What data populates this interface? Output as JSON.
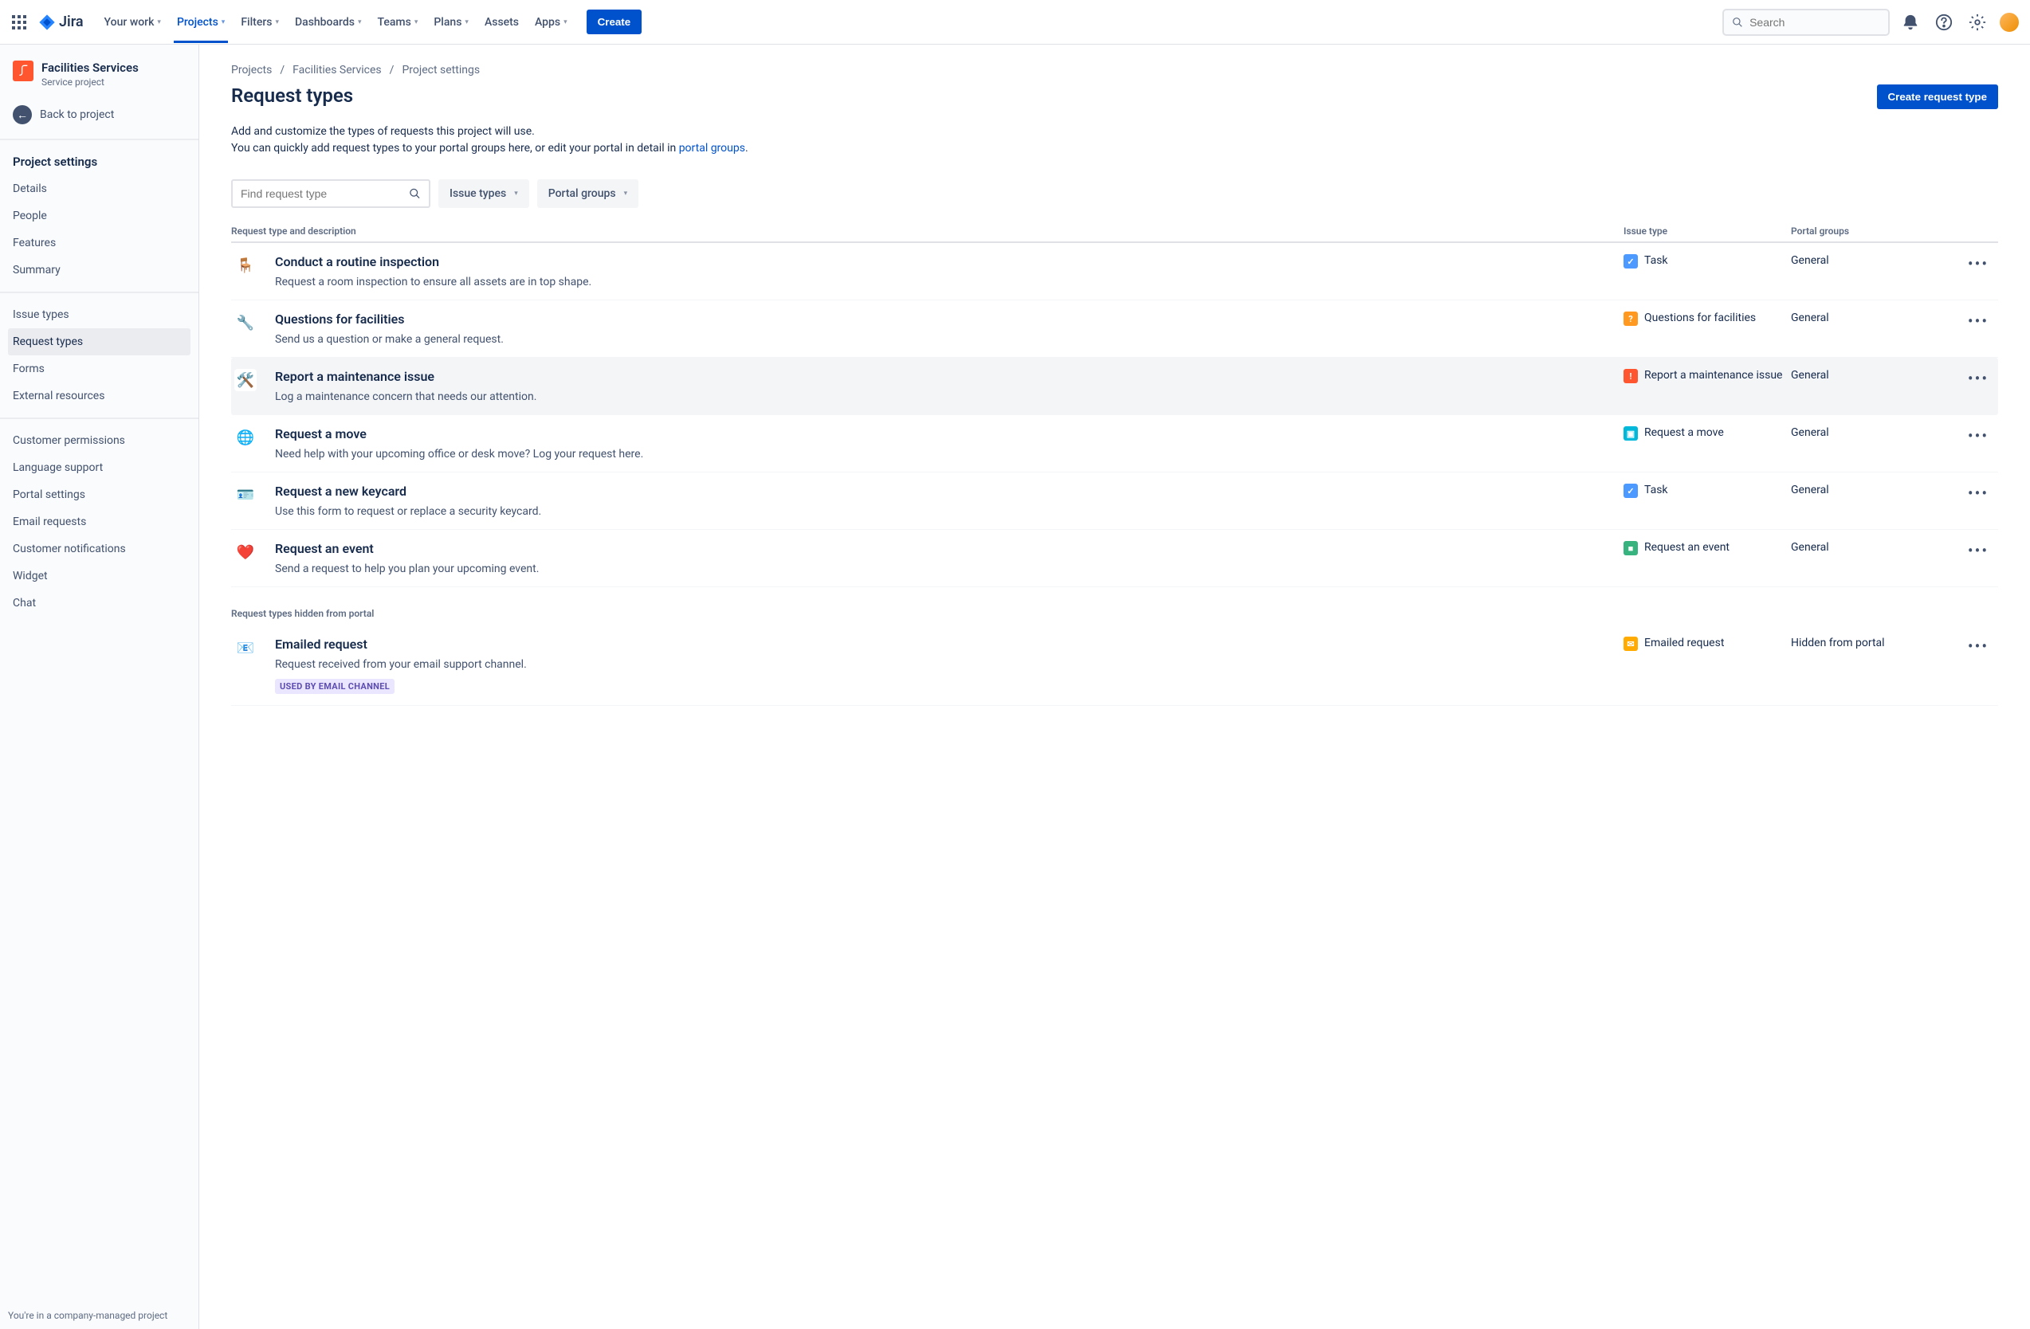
{
  "nav": {
    "brand": "Jira",
    "items": [
      "Your work",
      "Projects",
      "Filters",
      "Dashboards",
      "Teams",
      "Plans",
      "Assets",
      "Apps"
    ],
    "activeIndex": 1,
    "noChevron": [
      6
    ],
    "create": "Create",
    "searchPlaceholder": "Search"
  },
  "sidebar": {
    "project": {
      "name": "Facilities Services",
      "type": "Service project"
    },
    "back": "Back to project",
    "heading": "Project settings",
    "group1": [
      "Details",
      "People",
      "Features",
      "Summary"
    ],
    "group2": [
      "Issue types",
      "Request types",
      "Forms",
      "External resources"
    ],
    "group2Active": 1,
    "group3": [
      "Customer permissions",
      "Language support",
      "Portal settings",
      "Email requests",
      "Customer notifications",
      "Widget",
      "Chat"
    ],
    "footer": "You're in a company-managed project"
  },
  "breadcrumbs": [
    "Projects",
    "Facilities Services",
    "Project settings"
  ],
  "page": {
    "title": "Request types",
    "primary": "Create request type",
    "desc1": "Add and customize the types of requests this project will use.",
    "desc2a": "You can quickly add request types to your portal groups here, or edit your portal in detail in ",
    "desc2link": "portal groups",
    "desc2b": "."
  },
  "filters": {
    "findPlaceholder": "Find request type",
    "issueTypes": "Issue types",
    "portalGroups": "Portal groups",
    "cols": {
      "c1": "Request type and description",
      "c2": "Issue type",
      "c3": "Portal groups"
    }
  },
  "rows": [
    {
      "emoji": "🪑",
      "iconColor": "#6554C0",
      "title": "Conduct a routine inspection",
      "desc": "Request a room inspection to ensure all assets are in top shape.",
      "issue": "Task",
      "badge": "b-task",
      "group": "General"
    },
    {
      "emoji": "🔧",
      "iconColor": "#00B8D9",
      "title": "Questions for facilities",
      "desc": "Send us a question or make a general request.",
      "issue": "Questions for facilities",
      "badge": "b-orange",
      "group": "General"
    },
    {
      "emoji": "🛠️",
      "iconColor": "#FFAB00",
      "title": "Report a maintenance issue",
      "desc": "Log a maintenance concern that needs our attention.",
      "issue": "Report a maintenance issue",
      "badge": "b-red",
      "group": "General",
      "hl": true
    },
    {
      "emoji": "🌐",
      "iconColor": "#00B8D9",
      "title": "Request a move",
      "desc": "Need help with your upcoming office or desk move? Log your request here.",
      "issue": "Request a move",
      "badge": "b-teal",
      "group": "General"
    },
    {
      "emoji": "🪪",
      "iconColor": "#FFAB00",
      "title": "Request a new keycard",
      "desc": "Use this form to request or replace a security keycard.",
      "issue": "Task",
      "badge": "b-task",
      "group": "General"
    },
    {
      "emoji": "❤️",
      "iconColor": "#FF5630",
      "title": "Request an event",
      "desc": "Send a request to help you plan your upcoming event.",
      "issue": "Request an event",
      "badge": "b-green",
      "group": "General"
    }
  ],
  "hidden": {
    "label": "Request types hidden from portal",
    "rows": [
      {
        "emoji": "📧",
        "iconColor": "#00B8D9",
        "title": "Emailed request",
        "desc": "Request received from your email support channel.",
        "issue": "Emailed request",
        "badge": "b-yellow",
        "group": "Hidden from portal",
        "tag": "USED BY EMAIL CHANNEL"
      }
    ]
  }
}
